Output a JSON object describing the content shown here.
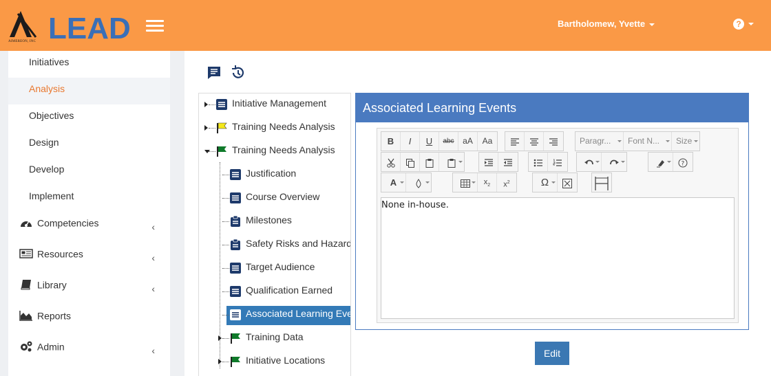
{
  "header": {
    "logo_text": "LEAD",
    "logo_subtext": "AIMEREON, INC",
    "user_name": "Bartholomew, Yvette",
    "help_symbol": "?"
  },
  "colors": {
    "header": "#fa9946",
    "accent": "#e9782f",
    "panel": "#4a7ac0",
    "button": "#3b78b3"
  },
  "sidebar": {
    "sub_items": [
      {
        "label": "Initiatives"
      },
      {
        "label": "Analysis"
      },
      {
        "label": "Objectives"
      },
      {
        "label": "Design"
      },
      {
        "label": "Develop"
      },
      {
        "label": "Implement"
      }
    ],
    "main_items": [
      {
        "label": "Competencies",
        "icon": "dashboard-icon"
      },
      {
        "label": "Resources",
        "icon": "newspaper-icon"
      },
      {
        "label": "Library",
        "icon": "book-icon"
      },
      {
        "label": "Reports",
        "icon": "area-chart-icon"
      },
      {
        "label": "Admin",
        "icon": "gears-icon"
      }
    ]
  },
  "tree": {
    "nodes": [
      {
        "label": "Initiative Management",
        "icon": "document-icon"
      },
      {
        "label": "Training Needs Analysis",
        "icon": "yellow-flag-icon"
      },
      {
        "label": "Training Needs Analysis",
        "icon": "green-flag-icon"
      },
      {
        "label": "Justification",
        "icon": "document-icon"
      },
      {
        "label": "Course Overview",
        "icon": "document-icon"
      },
      {
        "label": "Milestones",
        "icon": "clipboard-icon"
      },
      {
        "label": "Safety Risks and Hazards",
        "icon": "clipboard-icon"
      },
      {
        "label": "Target Audience",
        "icon": "document-icon"
      },
      {
        "label": "Qualification Earned",
        "icon": "document-icon"
      },
      {
        "label": "Associated Learning Events",
        "icon": "document-icon"
      },
      {
        "label": "Training Data",
        "icon": "green-flag-icon"
      },
      {
        "label": "Initiative Locations",
        "icon": "green-flag-icon"
      }
    ]
  },
  "panel": {
    "title": "Associated Learning Events",
    "content": "None in-house.",
    "paragraph_label": "Paragr...",
    "font_label": "Font N...",
    "size_label": "Size"
  },
  "edit_label": "Edit"
}
